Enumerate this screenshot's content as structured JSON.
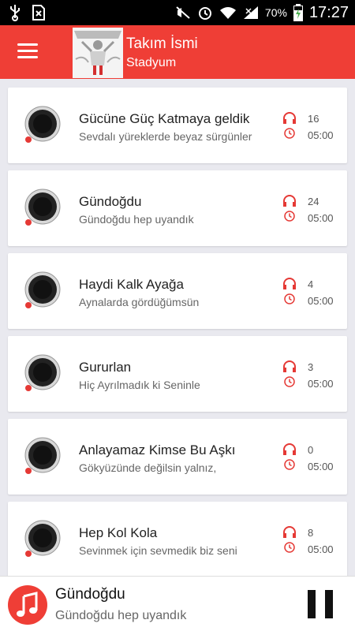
{
  "status_bar": {
    "battery_pct": "70%",
    "time": "17:27"
  },
  "app_bar": {
    "title": "Takım İsmi",
    "subtitle": "Stadyum"
  },
  "songs": [
    {
      "title": "Gücüne Güç Katmaya geldik",
      "subtitle": "Sevdalı yüreklerde beyaz sürgünler",
      "count": "16",
      "duration": "05:00"
    },
    {
      "title": "Gündoğdu",
      "subtitle": "Gündoğdu hep uyandık",
      "count": "24",
      "duration": "05:00"
    },
    {
      "title": "Haydi Kalk Ayağa",
      "subtitle": "Aynalarda gördüğümsün",
      "count": "4",
      "duration": "05:00"
    },
    {
      "title": "Gururlan",
      "subtitle": "Hiç Ayrılmadık ki Seninle",
      "count": "3",
      "duration": "05:00"
    },
    {
      "title": "Anlayamaz Kimse Bu Aşkı",
      "subtitle": "Gökyüzünde değilsin yalnız,",
      "count": "0",
      "duration": "05:00"
    },
    {
      "title": "Hep Kol Kola",
      "subtitle": "Sevinmek için sevmedik biz seni",
      "count": "8",
      "duration": "05:00"
    }
  ],
  "player": {
    "title": "Gündoğdu",
    "subtitle": "Gündoğdu hep uyandık",
    "icon": "music-note-icon",
    "control_icon": "pause-icon"
  },
  "colors": {
    "accent": "#ef3e36",
    "background": "#e9e9ef"
  }
}
